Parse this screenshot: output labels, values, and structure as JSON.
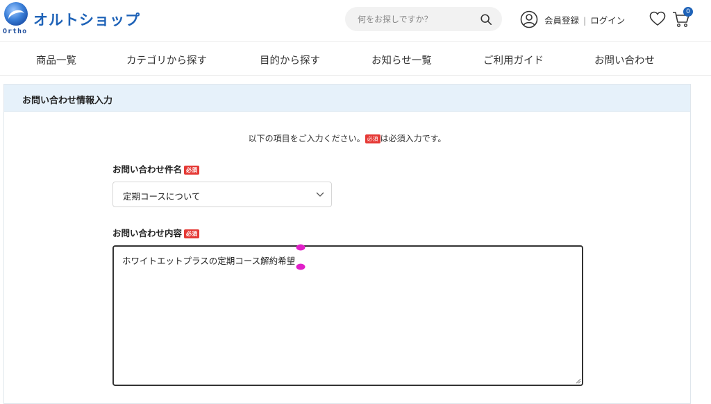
{
  "header": {
    "logo_text": "Ortho",
    "site_name": "オルトショップ",
    "search_placeholder": "何をお探しですか？",
    "account_register": "会員登録",
    "account_separator": "|",
    "account_login": "ログイン",
    "cart_count": "0"
  },
  "nav": {
    "items": [
      "商品一覧",
      "カテゴリから探す",
      "目的から探す",
      "お知らせ一覧",
      "ご利用ガイド",
      "お問い合わせ"
    ]
  },
  "form": {
    "title": "お問い合わせ情報入力",
    "note_before": "以下の項目をご入力ください。",
    "note_required": "必須",
    "note_after": "は必須入力です。",
    "subject_label": "お問い合わせ件名",
    "subject_required": "必須",
    "subject_value": "定期コースについて",
    "content_label": "お問い合わせ内容",
    "content_required": "必須",
    "content_value": "ホワイトエットプラスの定期コース解約希望"
  },
  "colors": {
    "brand_blue": "#1f63b8",
    "panel_header_bg": "#e6f1fa",
    "required_red": "#e53935",
    "selection_handle": "#e020c8"
  },
  "icons": {
    "search": "magnifier",
    "user": "user-circle",
    "favorite": "heart-outline",
    "cart": "shopping-cart",
    "select": "chevron-down"
  }
}
